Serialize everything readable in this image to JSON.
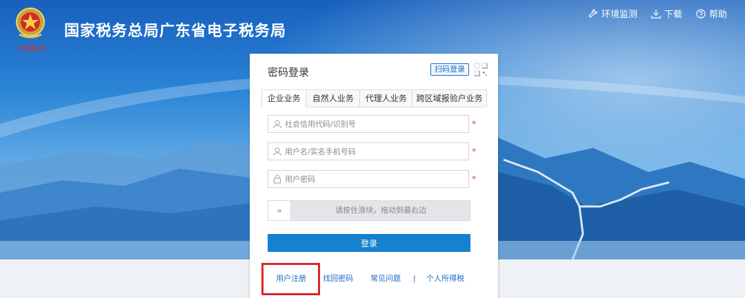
{
  "header": {
    "site_title": "国家税务总局广东省电子税务局",
    "nav": [
      {
        "label": "环境监测",
        "icon": "wrench-icon"
      },
      {
        "label": "下载",
        "icon": "download-icon"
      },
      {
        "label": "帮助",
        "icon": "help-icon"
      }
    ]
  },
  "login": {
    "title": "密码登录",
    "qr_switch_label": "扫码登录",
    "tabs": [
      {
        "label": "企业业务",
        "active": true
      },
      {
        "label": "自然人业务",
        "active": false
      },
      {
        "label": "代理人业务",
        "active": false
      },
      {
        "label": "跨区域报验户业务",
        "active": false
      }
    ],
    "fields": {
      "credit_code_placeholder": "社会信用代码/识别号",
      "username_placeholder": "用户名/实名手机号码",
      "password_placeholder": "用户密码",
      "required_mark": "*"
    },
    "slider": {
      "handle_label": "»",
      "hint": "请按住滑块，拖动到最右边"
    },
    "submit_label": "登录",
    "links": {
      "register": "用户注册",
      "recover": "找回密码",
      "faq": "常见问题",
      "separator": "|",
      "personal_tax": "个人所得税"
    }
  },
  "colors": {
    "primary_blue": "#1581cf",
    "link_blue": "#1a6ec2",
    "highlight_red": "#d9262c",
    "required_red": "#e23b3b"
  }
}
